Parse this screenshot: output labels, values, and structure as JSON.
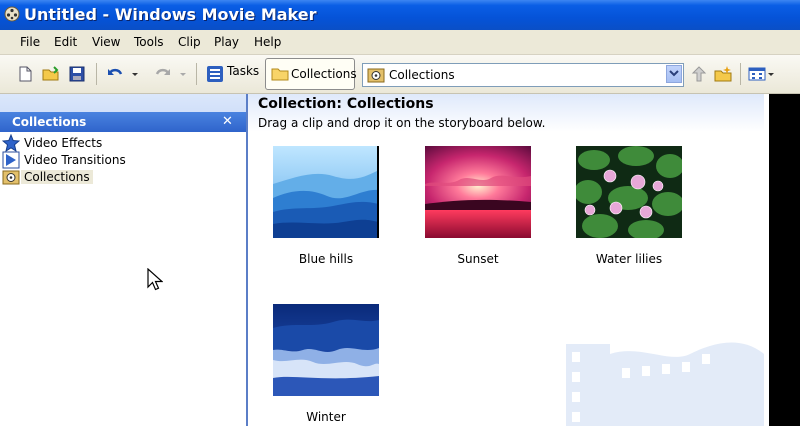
{
  "window": {
    "title": "Untitled - Windows Movie Maker"
  },
  "menu": [
    "File",
    "Edit",
    "View",
    "Tools",
    "Clip",
    "Play",
    "Help"
  ],
  "toolbar": {
    "tasks_label": "Tasks",
    "collections_label": "Collections",
    "combo_value": "Collections"
  },
  "left_pane": {
    "header": "Collections",
    "items": [
      {
        "label": "Video Effects",
        "icon": "star-icon"
      },
      {
        "label": "Video Transitions",
        "icon": "transition-icon"
      },
      {
        "label": "Collections",
        "icon": "collections-icon",
        "selected": true
      }
    ]
  },
  "content": {
    "title": "Collection: Collections",
    "subtitle": "Drag a clip and drop it on the storyboard below.",
    "clips": [
      {
        "caption": "Blue hills"
      },
      {
        "caption": "Sunset"
      },
      {
        "caption": "Water lilies"
      },
      {
        "caption": "Winter"
      }
    ]
  },
  "colors": {
    "title_bar": "#0553d8",
    "pane_border": "#5b7ec7",
    "menu_bg": "#ece9d8"
  }
}
